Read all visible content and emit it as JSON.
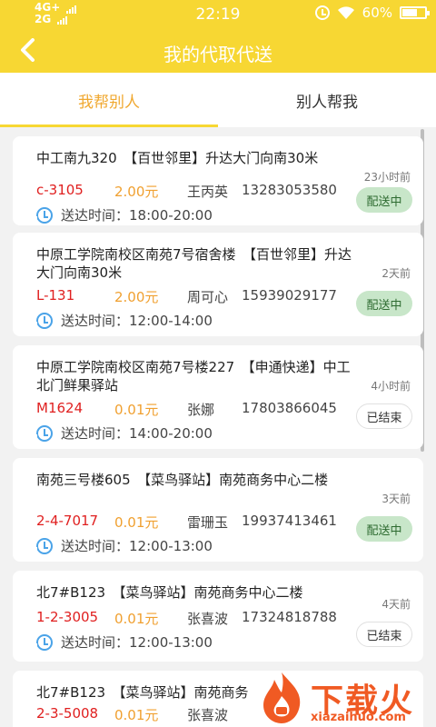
{
  "status_bar": {
    "network_top": "4G+",
    "network_bottom": "2G",
    "time": "22:19",
    "battery": "60%"
  },
  "header": {
    "title": "我的代取代送",
    "back_icon": "back-chevron-icon"
  },
  "tabs": [
    {
      "label": "我帮别人",
      "active": true
    },
    {
      "label": "别人帮我",
      "active": false
    }
  ],
  "orders": [
    {
      "address": "中工南九320　【百世邻里】升达大门向南30米",
      "code": "c-3105",
      "price": "2.00元",
      "name": "王丙英",
      "phone": "13283053580",
      "time_label": "送达时间：",
      "time_range": "18:00-20:00",
      "ago": "23小时前",
      "status": "配送中"
    },
    {
      "address": "中原工学院南校区南苑7号宿舍楼　【百世邻里】升达大门向南30米",
      "code": "L-131",
      "price": "2.00元",
      "name": "周可心",
      "phone": "15939029177",
      "time_label": "送达时间：",
      "time_range": "12:00-14:00",
      "ago": "2天前",
      "status": "配送中"
    },
    {
      "address": "中原工学院南校区南苑7号楼227　【申通快递】中工北门鲜果驿站",
      "code": "M1624",
      "price": "0.01元",
      "name": "张娜",
      "phone": "17803866045",
      "time_label": "送达时间：",
      "time_range": "14:00-20:00",
      "ago": "4小时前",
      "status": "已结束"
    },
    {
      "address": "南苑三号楼605　【菜鸟驿站】南苑商务中心二楼",
      "code": "2-4-7017",
      "price": "0.01元",
      "name": "雷珊玉",
      "phone": "19937413461",
      "time_label": "送达时间：",
      "time_range": "12:00-13:00",
      "ago": "3天前",
      "status": "配送中"
    },
    {
      "address": "北7#B123　【菜鸟驿站】南苑商务中心二楼",
      "code": "1-2-3005",
      "price": "0.01元",
      "name": "张喜波",
      "phone": "17324818788",
      "time_label": "送达时间：",
      "time_range": "12:00-13:00",
      "ago": "4天前",
      "status": "已结束"
    },
    {
      "address": "北7#B123　【菜鸟驿站】南苑商务",
      "code": "2-3-5008",
      "price": "0.01元",
      "name": "张喜波",
      "phone": "",
      "time_label": "",
      "time_range": "",
      "ago": "",
      "status": ""
    }
  ],
  "watermark": {
    "text": "下载火",
    "url": "xiazaihuo.com"
  },
  "colors": {
    "header": "#f7d733",
    "active_tab": "#f0a830",
    "code": "#e02020",
    "price": "#f0a030",
    "delivering_badge": "#c8e6c9"
  }
}
